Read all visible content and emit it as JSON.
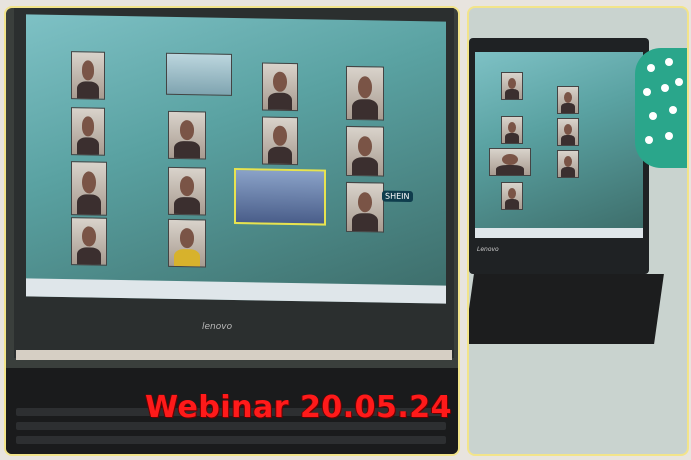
{
  "caption": {
    "text": "Webinar 20.05.24",
    "color": "#ff1a1a"
  },
  "left_laptop": {
    "brand": "lenovo",
    "screen_chips": [
      "SHEIN"
    ]
  },
  "right_laptop": {
    "brand": "Lenovo"
  },
  "colors": {
    "frame_border": "#f2e48a",
    "screen_teal": "#7ec1c5",
    "highlight_tile": "#e8e34f"
  }
}
